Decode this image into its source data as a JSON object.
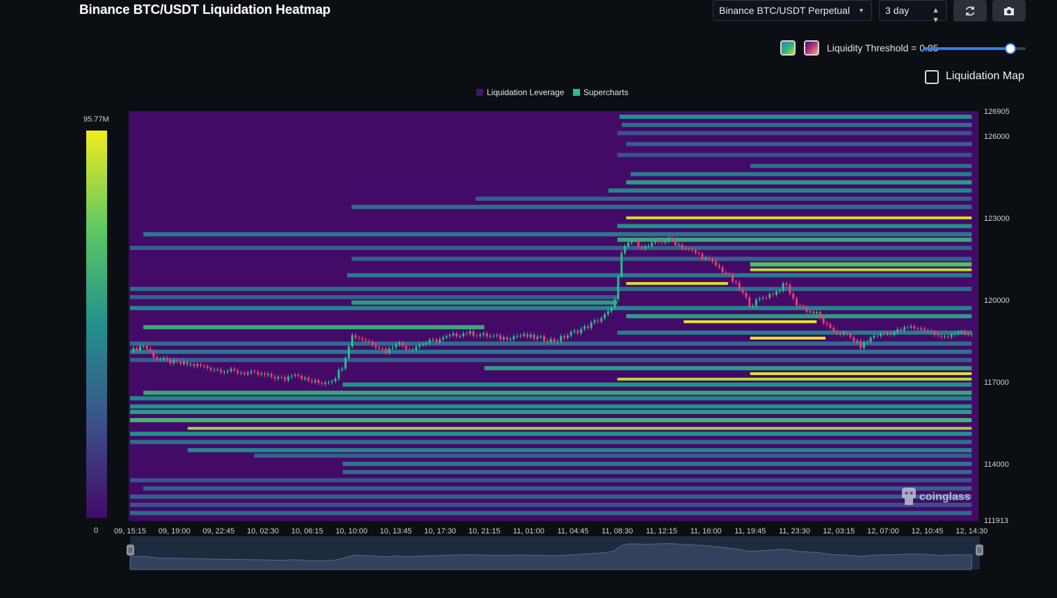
{
  "header": {
    "title": "Binance BTC/USDT Liquidation Heatmap",
    "exchange_select": "Binance BTC/USDT Perpetual",
    "range_select": "3 day",
    "refresh_icon": "refresh-icon",
    "camera_icon": "camera-icon"
  },
  "controls": {
    "swatch_1": "viridis-palette",
    "swatch_2": "magma-palette",
    "threshold_label": "Liquidity Threshold = 0.85",
    "threshold_value": 0.85,
    "map_checkbox_label": "Liquidation Map",
    "map_checkbox_checked": false
  },
  "legend": {
    "items": [
      {
        "label": "Liquidation Leverage",
        "color": "#3e1766"
      },
      {
        "label": "Supercharts",
        "color": "#23c28c"
      }
    ]
  },
  "colorbar": {
    "max_label": "95.77M",
    "min_label": "0"
  },
  "watermark": "coinglass",
  "colors": {
    "page_bg": "#0b0e13",
    "heatmap_low": "#440a68",
    "heatmap_high": "#f2ec1d",
    "candle_up": "#22c28a",
    "candle_down": "#e8406c",
    "slider_accent": "#2f7df6"
  },
  "chart_data": {
    "type": "heatmap",
    "title": "Binance BTC/USDT Liquidation Heatmap",
    "x_tick_labels": [
      "09, 15:15",
      "09, 19:00",
      "09, 22:45",
      "10, 02:30",
      "10, 06:15",
      "10, 10:00",
      "10, 13:45",
      "10, 17:30",
      "10, 21:15",
      "11, 01:00",
      "11, 04:45",
      "11, 08:30",
      "11, 12:15",
      "11, 16:00",
      "11, 19:45",
      "11, 23:30",
      "12, 03:15",
      "12, 07:00",
      "12, 10:45",
      "12, 14:30"
    ],
    "y_tick_labels": [
      "126905",
      "126000",
      "123000",
      "120000",
      "117000",
      "114000",
      "111913"
    ],
    "y_ticks": [
      126905,
      126000,
      123000,
      120000,
      117000,
      114000,
      111913
    ],
    "ylim": [
      111913,
      126905
    ],
    "colorbar_range": [
      0,
      95.77
    ],
    "colorbar_unit": "M",
    "liquidity_bands": [
      {
        "price": 126700,
        "start": 11.05,
        "end": 19.0,
        "intensity": 0.5
      },
      {
        "price": 126400,
        "start": 11.1,
        "end": 19.0,
        "intensity": 0.35
      },
      {
        "price": 126100,
        "start": 11.0,
        "end": 19.0,
        "intensity": 0.25
      },
      {
        "price": 125700,
        "start": 11.2,
        "end": 19.0,
        "intensity": 0.3
      },
      {
        "price": 125300,
        "start": 11.0,
        "end": 19.0,
        "intensity": 0.25
      },
      {
        "price": 124900,
        "start": 14.0,
        "end": 19.0,
        "intensity": 0.35
      },
      {
        "price": 124600,
        "start": 11.3,
        "end": 19.0,
        "intensity": 0.4
      },
      {
        "price": 124300,
        "start": 11.2,
        "end": 19.0,
        "intensity": 0.55
      },
      {
        "price": 124000,
        "start": 10.8,
        "end": 19.0,
        "intensity": 0.45
      },
      {
        "price": 123700,
        "start": 7.8,
        "end": 19.0,
        "intensity": 0.3
      },
      {
        "price": 123400,
        "start": 5.0,
        "end": 19.0,
        "intensity": 0.35
      },
      {
        "price": 123000,
        "start": 11.2,
        "end": 19.0,
        "intensity": 0.95
      },
      {
        "price": 122700,
        "start": 11.0,
        "end": 19.0,
        "intensity": 0.5
      },
      {
        "price": 122400,
        "start": 0.3,
        "end": 19.0,
        "intensity": 0.4
      },
      {
        "price": 122200,
        "start": 11.0,
        "end": 19.0,
        "intensity": 0.6
      },
      {
        "price": 121900,
        "start": 0.0,
        "end": 19.0,
        "intensity": 0.3
      },
      {
        "price": 121500,
        "start": 5.0,
        "end": 19.0,
        "intensity": 0.3
      },
      {
        "price": 121300,
        "start": 14.0,
        "end": 19.0,
        "intensity": 0.7
      },
      {
        "price": 121100,
        "start": 14.0,
        "end": 19.0,
        "intensity": 0.9
      },
      {
        "price": 120900,
        "start": 4.9,
        "end": 19.0,
        "intensity": 0.4
      },
      {
        "price": 120600,
        "start": 11.2,
        "end": 13.5,
        "intensity": 0.95
      },
      {
        "price": 120400,
        "start": 0.0,
        "end": 19.0,
        "intensity": 0.35
      },
      {
        "price": 120100,
        "start": 0.0,
        "end": 11.0,
        "intensity": 0.3
      },
      {
        "price": 119900,
        "start": 5.0,
        "end": 11.0,
        "intensity": 0.55
      },
      {
        "price": 119700,
        "start": 0.0,
        "end": 19.0,
        "intensity": 0.45
      },
      {
        "price": 119400,
        "start": 11.2,
        "end": 19.0,
        "intensity": 0.55
      },
      {
        "price": 119200,
        "start": 12.5,
        "end": 15.5,
        "intensity": 0.98
      },
      {
        "price": 119000,
        "start": 0.3,
        "end": 8.0,
        "intensity": 0.6
      },
      {
        "price": 118800,
        "start": 11.0,
        "end": 19.0,
        "intensity": 0.4
      },
      {
        "price": 118600,
        "start": 14.0,
        "end": 15.7,
        "intensity": 0.99
      },
      {
        "price": 118400,
        "start": 0.0,
        "end": 19.0,
        "intensity": 0.35
      },
      {
        "price": 118100,
        "start": 0.0,
        "end": 19.0,
        "intensity": 0.4
      },
      {
        "price": 117800,
        "start": 0.0,
        "end": 19.0,
        "intensity": 0.3
      },
      {
        "price": 117500,
        "start": 8.0,
        "end": 19.0,
        "intensity": 0.55
      },
      {
        "price": 117300,
        "start": 14.0,
        "end": 19.0,
        "intensity": 0.95
      },
      {
        "price": 117100,
        "start": 11.0,
        "end": 19.0,
        "intensity": 0.9
      },
      {
        "price": 116900,
        "start": 4.8,
        "end": 19.0,
        "intensity": 0.5
      },
      {
        "price": 116600,
        "start": 0.3,
        "end": 19.0,
        "intensity": 0.6
      },
      {
        "price": 116400,
        "start": 0.0,
        "end": 19.0,
        "intensity": 0.45
      },
      {
        "price": 116100,
        "start": 0.0,
        "end": 19.0,
        "intensity": 0.5
      },
      {
        "price": 115900,
        "start": 0.0,
        "end": 19.0,
        "intensity": 0.55
      },
      {
        "price": 115600,
        "start": 0.0,
        "end": 19.0,
        "intensity": 0.65
      },
      {
        "price": 115300,
        "start": 1.3,
        "end": 19.0,
        "intensity": 0.85
      },
      {
        "price": 115100,
        "start": 0.0,
        "end": 19.0,
        "intensity": 0.5
      },
      {
        "price": 114800,
        "start": 0.0,
        "end": 19.0,
        "intensity": 0.35
      },
      {
        "price": 114500,
        "start": 1.3,
        "end": 19.0,
        "intensity": 0.45
      },
      {
        "price": 114300,
        "start": 2.8,
        "end": 19.0,
        "intensity": 0.3
      },
      {
        "price": 114000,
        "start": 4.8,
        "end": 19.0,
        "intensity": 0.4
      },
      {
        "price": 113700,
        "start": 4.8,
        "end": 19.0,
        "intensity": 0.35
      },
      {
        "price": 113400,
        "start": 0.0,
        "end": 19.0,
        "intensity": 0.25
      },
      {
        "price": 113100,
        "start": 0.3,
        "end": 19.0,
        "intensity": 0.3
      },
      {
        "price": 112800,
        "start": 0.0,
        "end": 19.0,
        "intensity": 0.3
      },
      {
        "price": 112500,
        "start": 0.0,
        "end": 19.0,
        "intensity": 0.25
      },
      {
        "price": 112200,
        "start": 0.0,
        "end": 19.0,
        "intensity": 0.35
      }
    ],
    "price_path": [
      {
        "t": 0.0,
        "p": 118100
      },
      {
        "t": 0.3,
        "p": 118350
      },
      {
        "t": 0.6,
        "p": 117850
      },
      {
        "t": 1.0,
        "p": 117700
      },
      {
        "t": 1.5,
        "p": 117600
      },
      {
        "t": 2.0,
        "p": 117450
      },
      {
        "t": 2.5,
        "p": 117350
      },
      {
        "t": 3.0,
        "p": 117250
      },
      {
        "t": 3.5,
        "p": 117100
      },
      {
        "t": 3.7,
        "p": 117350
      },
      {
        "t": 4.0,
        "p": 117050
      },
      {
        "t": 4.3,
        "p": 116950
      },
      {
        "t": 4.6,
        "p": 117100
      },
      {
        "t": 4.8,
        "p": 117600
      },
      {
        "t": 5.0,
        "p": 118700
      },
      {
        "t": 5.2,
        "p": 118600
      },
      {
        "t": 5.5,
        "p": 118400
      },
      {
        "t": 5.8,
        "p": 118100
      },
      {
        "t": 6.0,
        "p": 118450
      },
      {
        "t": 6.3,
        "p": 118200
      },
      {
        "t": 6.6,
        "p": 118400
      },
      {
        "t": 7.0,
        "p": 118550
      },
      {
        "t": 7.3,
        "p": 118700
      },
      {
        "t": 7.6,
        "p": 118800
      },
      {
        "t": 8.0,
        "p": 118700
      },
      {
        "t": 8.4,
        "p": 118600
      },
      {
        "t": 8.8,
        "p": 118700
      },
      {
        "t": 9.2,
        "p": 118600
      },
      {
        "t": 9.6,
        "p": 118500
      },
      {
        "t": 10.0,
        "p": 118800
      },
      {
        "t": 10.3,
        "p": 119000
      },
      {
        "t": 10.7,
        "p": 119400
      },
      {
        "t": 10.9,
        "p": 119700
      },
      {
        "t": 11.0,
        "p": 120600
      },
      {
        "t": 11.1,
        "p": 121700
      },
      {
        "t": 11.3,
        "p": 122200
      },
      {
        "t": 11.6,
        "p": 121900
      },
      {
        "t": 11.9,
        "p": 122100
      },
      {
        "t": 12.2,
        "p": 122200
      },
      {
        "t": 12.5,
        "p": 121900
      },
      {
        "t": 12.8,
        "p": 121700
      },
      {
        "t": 13.2,
        "p": 121300
      },
      {
        "t": 13.5,
        "p": 120900
      },
      {
        "t": 13.8,
        "p": 120300
      },
      {
        "t": 14.0,
        "p": 119800
      },
      {
        "t": 14.3,
        "p": 120100
      },
      {
        "t": 14.6,
        "p": 120300
      },
      {
        "t": 14.8,
        "p": 120600
      },
      {
        "t": 15.0,
        "p": 119900
      },
      {
        "t": 15.3,
        "p": 119600
      },
      {
        "t": 15.5,
        "p": 119500
      },
      {
        "t": 15.8,
        "p": 118900
      },
      {
        "t": 16.2,
        "p": 118700
      },
      {
        "t": 16.5,
        "p": 118300
      },
      {
        "t": 16.8,
        "p": 118700
      },
      {
        "t": 17.2,
        "p": 118800
      },
      {
        "t": 17.6,
        "p": 119000
      },
      {
        "t": 18.0,
        "p": 118900
      },
      {
        "t": 18.3,
        "p": 118600
      },
      {
        "t": 18.6,
        "p": 118800
      },
      {
        "t": 19.0,
        "p": 118700
      }
    ]
  }
}
